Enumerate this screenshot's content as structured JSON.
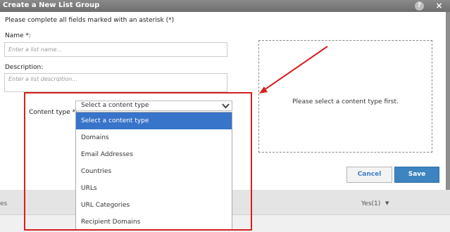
{
  "dialog": {
    "title": "Create a New List Group",
    "help": "?",
    "close": "×",
    "instructions": "Please complete all fields marked with an asterisk (*)"
  },
  "name": {
    "label": "Name *:",
    "placeholder": "Enter a list name..."
  },
  "description": {
    "label": "Description:",
    "placeholder": "Enter a list description..."
  },
  "content_type": {
    "label": "Content type *:",
    "selected": "Select a content type",
    "options": [
      "Select a content type",
      "Domains",
      "Email Addresses",
      "Countries",
      "URLs",
      "URL Categories",
      "Recipient Domains"
    ]
  },
  "preview": {
    "message": "Please select a content type first."
  },
  "buttons": {
    "cancel": "Cancel",
    "save": "Save"
  },
  "background": {
    "partial": "es",
    "filter": "Yes(1)",
    "caret": "▼"
  },
  "colors": {
    "annotation": "#d42020",
    "selected_option": "#3874c9",
    "save_button": "#3d84c0"
  },
  "icons": {
    "chevron": "chevron-down-icon",
    "arrow": "annotation-arrow"
  }
}
